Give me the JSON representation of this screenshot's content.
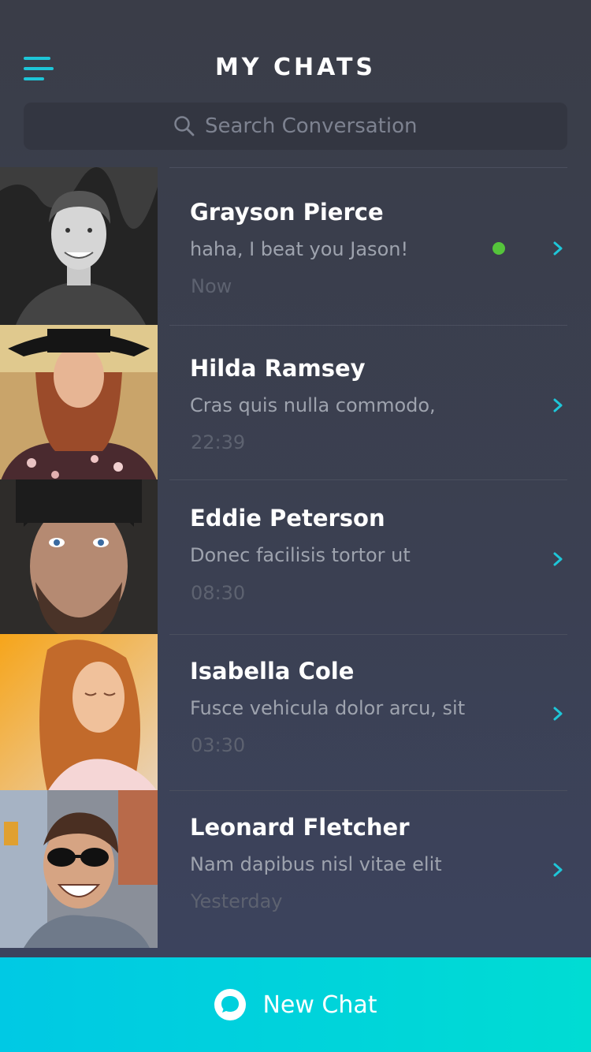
{
  "header": {
    "title": "MY CHATS",
    "menu_icon": "hamburger-menu-icon"
  },
  "search": {
    "placeholder": "Search Conversation",
    "icon": "search-icon"
  },
  "chats": [
    {
      "name": "Grayson Pierce",
      "message": "haha, I beat you Jason!",
      "time": "Now",
      "online": true
    },
    {
      "name": "Hilda Ramsey",
      "message": "Cras quis nulla commodo,",
      "time": "22:39",
      "online": false
    },
    {
      "name": "Eddie Peterson",
      "message": "Donec facilisis tortor ut",
      "time": "08:30",
      "online": false
    },
    {
      "name": "Isabella Cole",
      "message": "Fusce vehicula dolor arcu, sit",
      "time": "03:30",
      "online": false
    },
    {
      "name": "Leonard Fletcher",
      "message": "Nam dapibus nisl vitae elit",
      "time": "Yesterday",
      "online": false
    }
  ],
  "new_chat": {
    "label": "New Chat",
    "icon": "chat-bubble-icon"
  },
  "colors": {
    "accent": "#1ec6d8",
    "online": "#55c43b",
    "button_gradient_start": "#00c9e4",
    "button_gradient_end": "#00dcd3"
  }
}
